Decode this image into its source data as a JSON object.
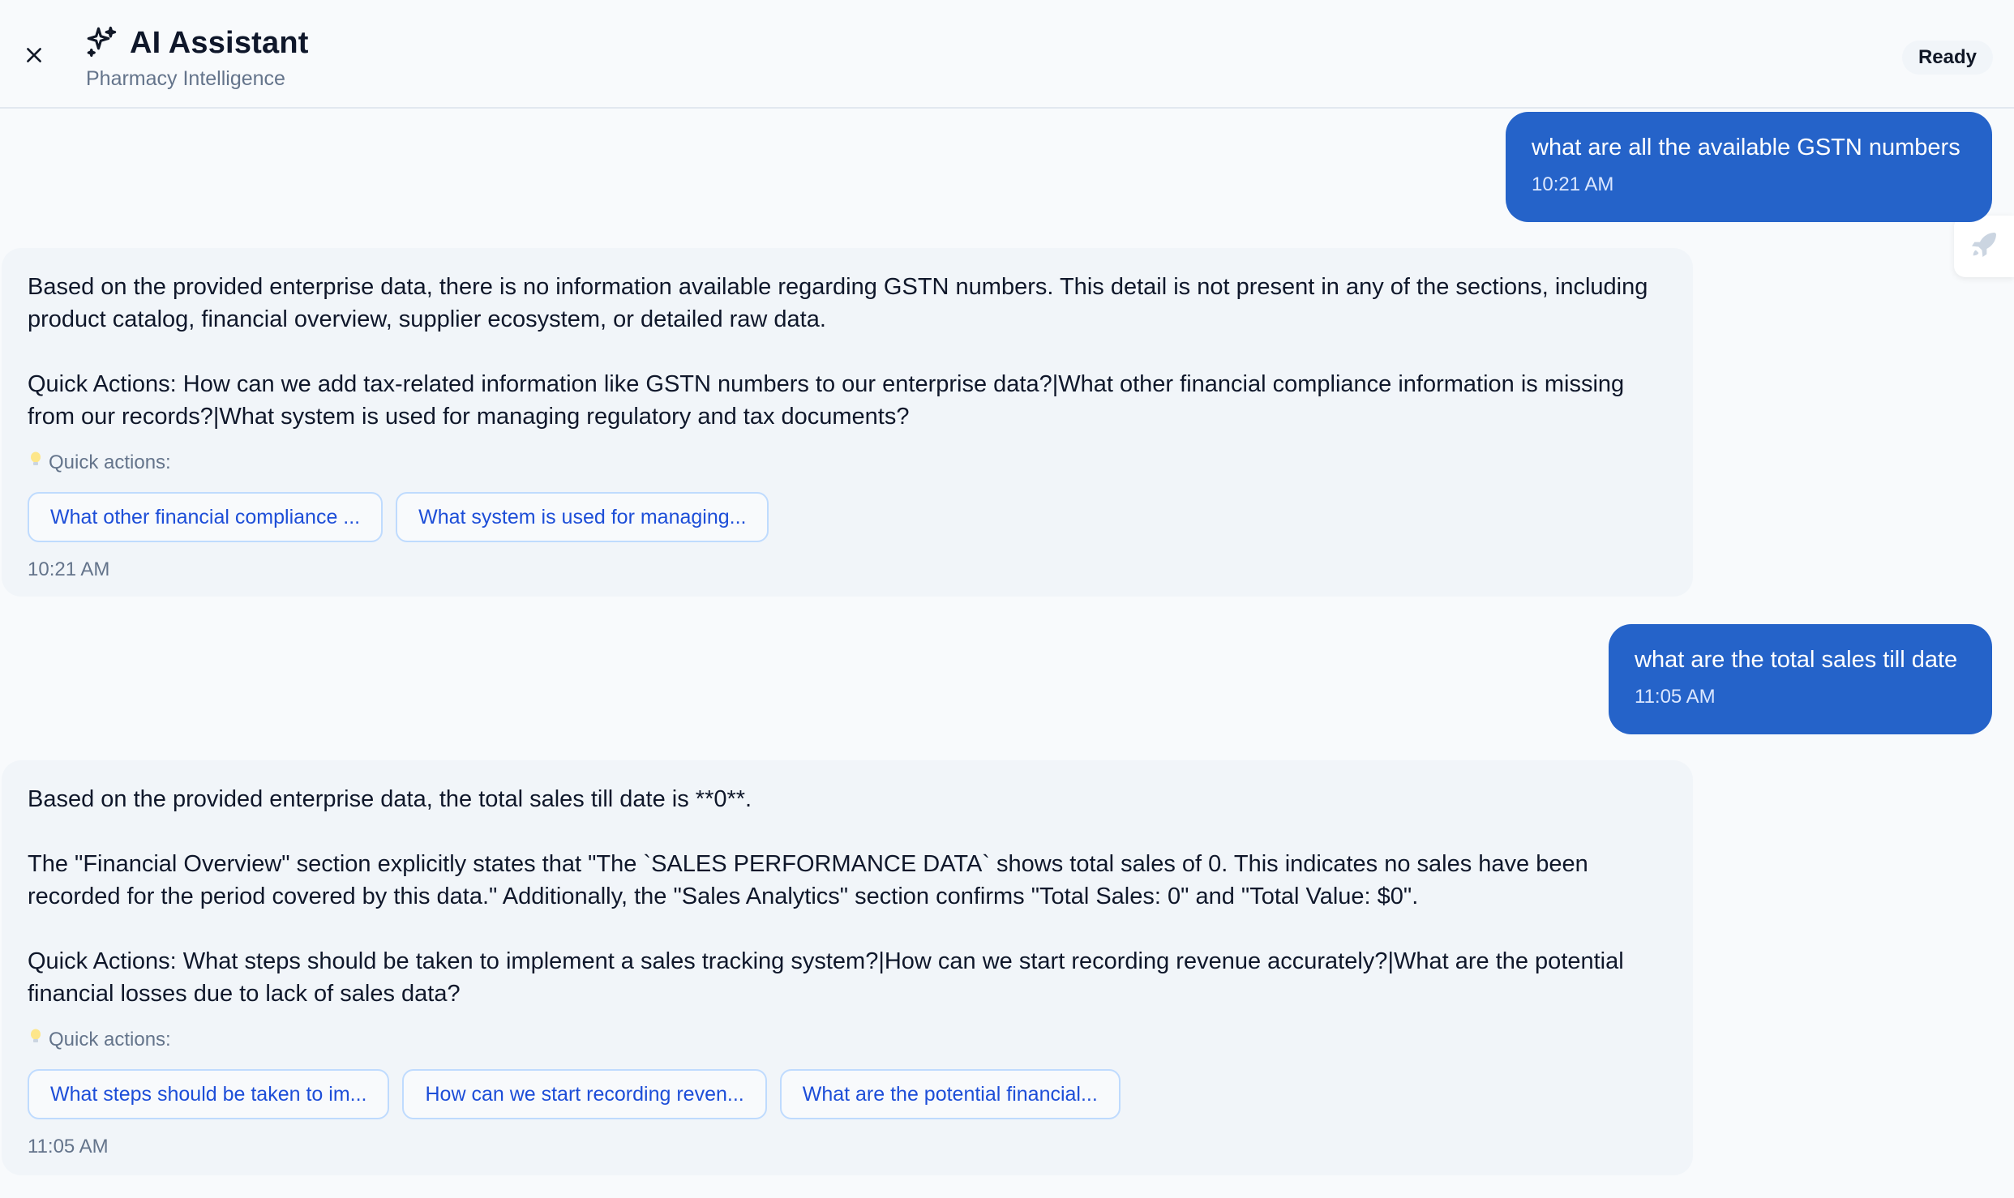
{
  "header": {
    "title": "AI Assistant",
    "subtitle": "Pharmacy Intelligence",
    "status": "Ready",
    "icons": {
      "close": "close-icon",
      "title": "sparkle-icon",
      "side_tab": "rocket-icon"
    }
  },
  "messages": [
    {
      "role": "user",
      "text": "what are all the available GSTN numbers",
      "time": "10:21 AM"
    },
    {
      "role": "assistant",
      "paragraphs": [
        "Based on the provided enterprise data, there is no information available regarding GSTN numbers. This detail is not present in any of the sections, including product catalog, financial overview, supplier ecosystem, or detailed raw data.",
        "Quick Actions: How can we add tax-related information like GSTN numbers to our enterprise data?|What other financial compliance information is missing from our records?|What system is used for managing regulatory and tax documents?"
      ],
      "quick_actions_label": "Quick actions:",
      "quick_actions": [
        "What other financial compliance ...",
        "What system is used for managing..."
      ],
      "time": "10:21 AM"
    },
    {
      "role": "user",
      "text": "what are the total sales till date",
      "time": "11:05 AM"
    },
    {
      "role": "assistant",
      "paragraphs": [
        "Based on the provided enterprise data, the total sales till date is **0**.",
        "The \"Financial Overview\" section explicitly states that \"The `SALES PERFORMANCE DATA` shows total sales of 0. This indicates no sales have been recorded for the period covered by this data.\" Additionally, the \"Sales Analytics\" section confirms \"Total Sales: 0\" and \"Total Value: $0\".",
        "Quick Actions: What steps should be taken to implement a sales tracking system?|How can we start recording revenue accurately?|What are the potential financial losses due to lack of sales data?"
      ],
      "quick_actions_label": "Quick actions:",
      "quick_actions": [
        "What steps should be taken to im...",
        "How can we start recording reven...",
        "What are the potential financial..."
      ],
      "time": "11:05 AM"
    }
  ],
  "colors": {
    "user_bubble": "#2563c9",
    "assistant_bubble": "#f1f5f9",
    "chip_text": "#1d4ed8",
    "chip_border": "#bfdbfe"
  }
}
